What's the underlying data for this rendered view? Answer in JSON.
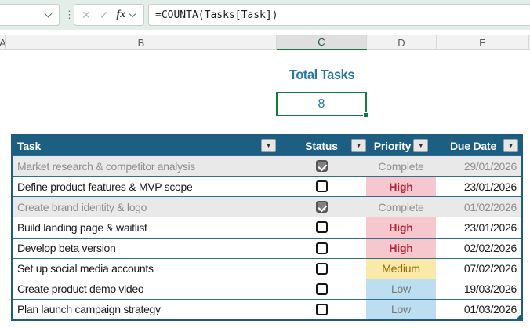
{
  "formula_bar": {
    "formula": "=COUNTA(Tasks[Task])",
    "fx_label": "fx",
    "cancel_glyph": "✕",
    "enter_glyph": "✓"
  },
  "columns": {
    "letters": [
      "A",
      "B",
      "C",
      "D",
      "E"
    ],
    "selected": "C"
  },
  "summary": {
    "title": "Total Tasks",
    "value": "8"
  },
  "task_table": {
    "headers": [
      "Task",
      "Status",
      "Priority",
      "Due Date"
    ],
    "rows": [
      {
        "task": "Market research & competitor analysis",
        "status_checked": true,
        "priority": "Complete",
        "due_date": "29/01/2026"
      },
      {
        "task": "Define product features & MVP scope",
        "status_checked": false,
        "priority": "High",
        "due_date": "23/01/2026"
      },
      {
        "task": "Create brand identity & logo",
        "status_checked": true,
        "priority": "Complete",
        "due_date": "01/02/2026"
      },
      {
        "task": "Build landing page & waitlist",
        "status_checked": false,
        "priority": "High",
        "due_date": "23/01/2026"
      },
      {
        "task": "Develop beta version",
        "status_checked": false,
        "priority": "High",
        "due_date": "02/02/2026"
      },
      {
        "task": "Set up social media accounts",
        "status_checked": false,
        "priority": "Medium",
        "due_date": "07/02/2026"
      },
      {
        "task": "Create product demo video",
        "status_checked": false,
        "priority": "Low",
        "due_date": "19/03/2026"
      },
      {
        "task": "Plan launch campaign strategy",
        "status_checked": false,
        "priority": "Low",
        "due_date": "01/03/2026"
      }
    ]
  },
  "colors": {
    "table_header_bg": "#1C5F82",
    "row_border": "#2E6E90",
    "selection_green": "#107C41",
    "title_blue": "#2979A2",
    "high_bg": "#F6C8CD",
    "high_text": "#B02B3A",
    "medium_bg": "#FBE9A9",
    "medium_text": "#9A6B00",
    "low_bg": "#BCDEF0",
    "low_text": "#77797B",
    "complete_text": "#8F8F8F"
  }
}
